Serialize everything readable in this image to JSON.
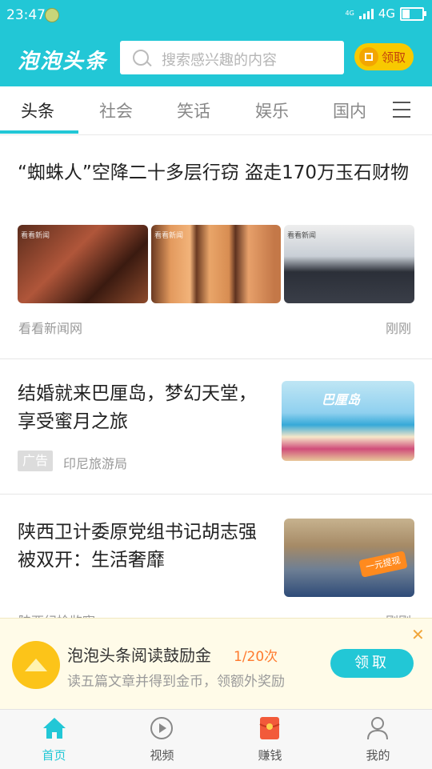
{
  "status_bar": {
    "time": "23:47",
    "network": "4G",
    "small_network": "4G"
  },
  "header": {
    "logo": "泡泡头条",
    "search_placeholder": "搜索感兴趣的内容",
    "claim_label": "领取"
  },
  "tabs": [
    "头条",
    "社会",
    "笑话",
    "娱乐",
    "国内"
  ],
  "articles": [
    {
      "title": "“蜘蛛人”空降二十多层行窃 盗走170万玉石财物",
      "source": "看看新闻网",
      "time": "刚刚",
      "watermark": "看看新闻"
    },
    {
      "title": "结婚就来巴厘岛，梦幻天堂，享受蜜月之旅",
      "ad_tag": "广告",
      "source": "印尼旅游局",
      "image_text": "巴厘岛"
    },
    {
      "title": "陕西卫计委原党组书记胡志强被双开：生活奢靡",
      "source": "陕西纪检监察",
      "time": "刚刚",
      "badge": "一元提现"
    }
  ],
  "reward_banner": {
    "title": "泡泡头条阅读鼓励金",
    "count": "1/20次",
    "subtitle": "读五篇文章并得到金币，领额外奖励",
    "button": "领取"
  },
  "bottom_nav": [
    {
      "label": "首页",
      "icon": "home-icon"
    },
    {
      "label": "视频",
      "icon": "video-play-icon"
    },
    {
      "label": "赚钱",
      "icon": "red-envelope-icon"
    },
    {
      "label": "我的",
      "icon": "profile-icon"
    }
  ],
  "colors": {
    "brand": "#22c7d6",
    "accent_yellow": "#f8c900",
    "count": "#ff7a2e"
  }
}
